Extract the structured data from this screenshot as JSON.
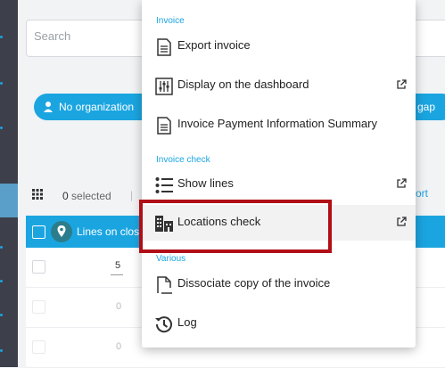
{
  "background": {
    "search_placeholder": "Search",
    "filter_pill_label": "No organization",
    "filter_pill_right_fragment": "gap",
    "selected_count": "0",
    "selected_label": "selected",
    "toolbar_right_fragment": "ort",
    "grid_header_label": "Lines on close",
    "rows": [
      {
        "value": "5"
      },
      {
        "value": "0"
      },
      {
        "value": "0"
      }
    ]
  },
  "menu": {
    "sections": [
      {
        "title": "Invoice",
        "items": [
          {
            "label": "Export invoice",
            "icon": "document-icon",
            "external": false
          },
          {
            "label": "Display on the dashboard",
            "icon": "sliders-icon",
            "external": true
          },
          {
            "label": "Invoice Payment Information Summary",
            "icon": "document-icon",
            "external": false
          }
        ]
      },
      {
        "title": "Invoice check",
        "items": [
          {
            "label": "Show lines",
            "icon": "list-icon",
            "external": true
          },
          {
            "label": "Locations check",
            "icon": "buildings-icon",
            "external": true,
            "highlighted": true
          }
        ]
      },
      {
        "title": "Various",
        "items": [
          {
            "label": "Dissociate copy of the invoice",
            "icon": "document-corner-icon",
            "external": false
          },
          {
            "label": "Log",
            "icon": "history-icon",
            "external": false
          }
        ]
      }
    ]
  },
  "colors": {
    "accent": "#1ba5e0",
    "highlight_border": "#b10e17",
    "sidebar": "#3d3f4a"
  }
}
